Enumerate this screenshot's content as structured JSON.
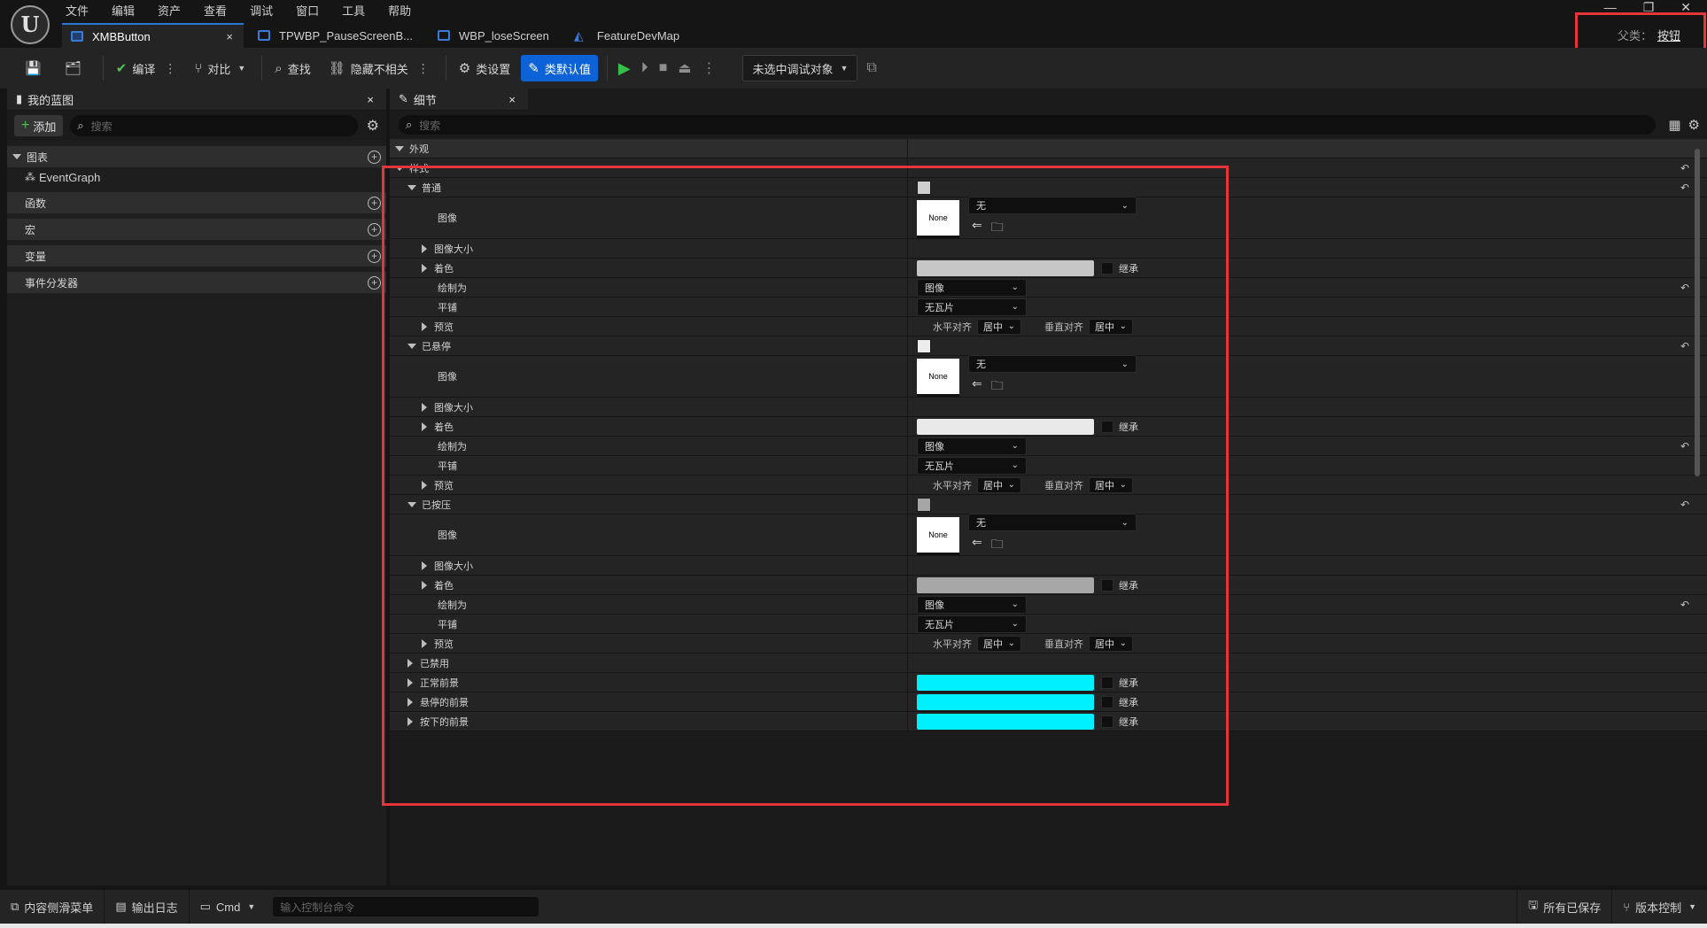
{
  "menu": [
    "文件",
    "编辑",
    "资产",
    "查看",
    "调试",
    "窗口",
    "工具",
    "帮助"
  ],
  "logo_text": "U",
  "tabs": [
    {
      "label": "XMBButton",
      "active": true,
      "close": "×"
    },
    {
      "label": "TPWBP_PauseScreenB...",
      "active": false
    },
    {
      "label": "WBP_loseScreen",
      "active": false
    },
    {
      "label": "FeatureDevMap",
      "active": false
    }
  ],
  "window_controls": [
    "—",
    "❐",
    "✕"
  ],
  "parent_class": {
    "label": "父类：",
    "value": "按钮"
  },
  "toolbar": {
    "compile": "编译",
    "diff": "对比",
    "find": "查找",
    "hide_unrelated": "隐藏不相关",
    "class_settings": "类设置",
    "class_defaults": "类默认值",
    "debug_target": "未选中调试对象"
  },
  "left_panel": {
    "tab": "我的蓝图",
    "close": "×",
    "add": "添加",
    "search_placeholder": "搜索",
    "graphs": "图表",
    "event_graph": "EventGraph",
    "functions": "函数",
    "macros": "宏",
    "variables": "变量",
    "dispatchers": "事件分发器"
  },
  "details": {
    "tab": "细节",
    "close": "×",
    "search_placeholder": "搜索",
    "appearance": "外观",
    "style": "样式",
    "states": [
      {
        "name": "普通",
        "swatch": "#cfcfcf",
        "tint": "#c6c6c6"
      },
      {
        "name": "已悬停",
        "swatch": "#ececec",
        "tint": "#e9e9e9"
      },
      {
        "name": "已按压",
        "swatch": "#a6a6a6",
        "tint": "#a7a7a7"
      }
    ],
    "image_label": "图像",
    "image_none": "None",
    "image_combo": "无",
    "image_size": "图像大小",
    "tint": "着色",
    "inherit": "继承",
    "draw_as": "绘制为",
    "draw_as_value": "图像",
    "tiling": "平铺",
    "tiling_value": "无瓦片",
    "preview": "预览",
    "h_align": "水平对齐",
    "v_align": "垂直对齐",
    "align_value": "居中",
    "disabled": "已禁用",
    "foregrounds": [
      {
        "name": "正常前景",
        "color": "#00f0ff"
      },
      {
        "name": "悬停的前景",
        "color": "#00f0ff"
      },
      {
        "name": "按下的前景",
        "color": "#00f0ff"
      }
    ]
  },
  "statusbar": {
    "content_drawer": "内容侧滑菜单",
    "output_log": "输出日志",
    "cmd": "Cmd",
    "cmd_placeholder": "输入控制台命令",
    "all_saved": "所有已保存",
    "source_control": "版本控制"
  },
  "colors": {
    "accent": "#0d62d8",
    "highlight": "#e5353a",
    "play": "#36c04a"
  }
}
